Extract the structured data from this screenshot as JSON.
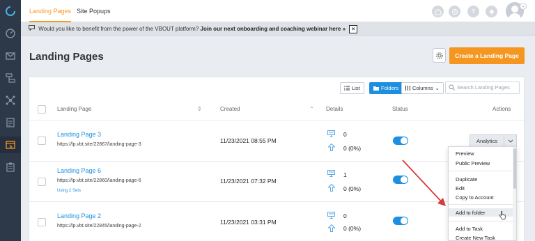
{
  "tabs": {
    "landing": "Landing Pages",
    "popups": "Site Popups"
  },
  "banner": {
    "text": "Would you like to benefit from the power of the VBOUT platform?",
    "link": "Join our next onboarding and coaching webinar here",
    "link_suffix": "»",
    "close": "×"
  },
  "page": {
    "title": "Landing Pages",
    "create_button": "Create a Landing Page"
  },
  "toolbar": {
    "list": "List",
    "folders": "Folders",
    "columns": "Columns",
    "search_placeholder": "Search Landing Pages"
  },
  "table": {
    "headers": {
      "landing": "Landing Page",
      "created": "Created",
      "details": "Details",
      "status": "Status",
      "actions": "Actions"
    },
    "rows": [
      {
        "name": "Landing Page 3",
        "url": "https://lp.vbt.site/22867/landing-page-3",
        "extra": "",
        "created": "11/23/2021 08:55 PM",
        "views": "0",
        "conversions": "0 (0%)"
      },
      {
        "name": "Landing Page 6",
        "url": "https://lp.vbt.site/22860/landing-page-6",
        "extra": "Using 2 Sets",
        "created": "11/23/2021 07:32 PM",
        "views": "1",
        "conversions": "0 (0%)"
      },
      {
        "name": "Landing Page 2",
        "url": "https://lp.vbt.site/22845/landing-page-2",
        "extra": "",
        "created": "11/23/2021 03:31 PM",
        "views": "0",
        "conversions": "0 (0%)"
      }
    ]
  },
  "actions": {
    "analytics": "Analytics"
  },
  "dropdown": {
    "preview": "Preview",
    "public_preview": "Public Preview",
    "duplicate": "Duplicate",
    "edit": "Edit",
    "copy_to_account": "Copy to Account",
    "add_to_folder": "Add to folder",
    "add_to_task": "Add to Task",
    "create_new_task": "Create New Task"
  },
  "colors": {
    "accent": "#f4961f",
    "primary": "#1d8fe0",
    "sidebar": "#2d3848",
    "annotation_arrow": "#d63b3b"
  }
}
